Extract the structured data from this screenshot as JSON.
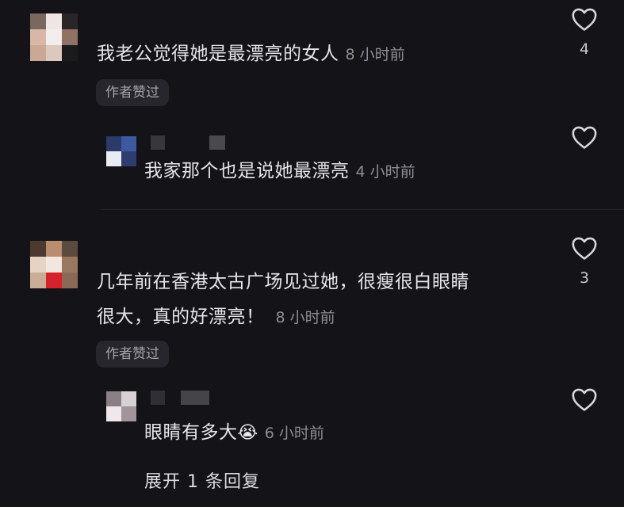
{
  "comments": [
    {
      "text": "我老公觉得她是最漂亮的女人",
      "time": "8 小时前",
      "likes": "4",
      "badge": "作者赞过",
      "reply": {
        "text": "我家那个也是说她最漂亮",
        "time": "4 小时前"
      }
    },
    {
      "text_line1": "几年前在香港太古广场见过她，很瘦很白眼睛",
      "text_line2": "很大，真的好漂亮！",
      "time": "8 小时前",
      "likes": "3",
      "badge": "作者赞过",
      "reply": {
        "text": "眼睛有多大",
        "emoji": "😭",
        "time": "6 小时前"
      },
      "expand_label": "展开 1 条回复"
    }
  ],
  "colors": {
    "background": "#141318",
    "text": "#e6e6ea",
    "muted": "#8e8e94",
    "badge_bg": "#27262c"
  }
}
